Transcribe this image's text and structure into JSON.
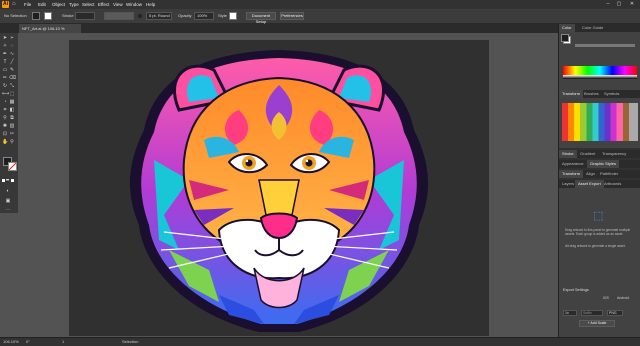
{
  "app": {
    "logo_text": "Ai"
  },
  "menu": [
    "File",
    "Edit",
    "Object",
    "Type",
    "Select",
    "Effect",
    "View",
    "Window",
    "Help"
  ],
  "control_bar": {
    "selection": "No Selection",
    "stroke_label": "Stroke",
    "stroke_style": "5 pt. Round",
    "opacity_label": "Opacity",
    "opacity_value": "100%",
    "style_label": "Style",
    "document_setup": "Document Setup",
    "preferences": "Preferences"
  },
  "document_tab": {
    "title": "NFT_Art.ai @ 106.10 % (RGB/Preview)",
    "close": "×"
  },
  "panels": {
    "color_tabs": [
      "Color",
      "Color Guide"
    ],
    "swatch_tabs": [
      "Transform",
      "Brushes",
      "Symbols"
    ],
    "stroke_tabs": [
      "Stroke",
      "Gradient",
      "Transparency"
    ],
    "appearance_tabs": [
      "Appearance",
      "Graphic Styles"
    ],
    "transform_tabs": [
      "Transform",
      "Align",
      "Pathfinder"
    ],
    "export_tabs": [
      "Layers",
      "Asset Export",
      "Artboards"
    ],
    "asset_export_hint1": "Drag artwork to this panel to generate multiple assets. Each group is added as an asset.",
    "asset_export_hint2": "Alt drag artwork to generate a single asset.",
    "export_settings": "Export Settings",
    "scale_value": "1x",
    "suffix": "Suffix",
    "format": "PNG",
    "ios": "iOS",
    "android": "Android",
    "add_scale": "+ Add Scale"
  },
  "statusbar": {
    "zoom": "106.10%",
    "rotation": "0°",
    "artboard": "1",
    "mode": "Selection"
  },
  "colors": {
    "accent": "#ff9a00",
    "artboard": "#303030"
  }
}
